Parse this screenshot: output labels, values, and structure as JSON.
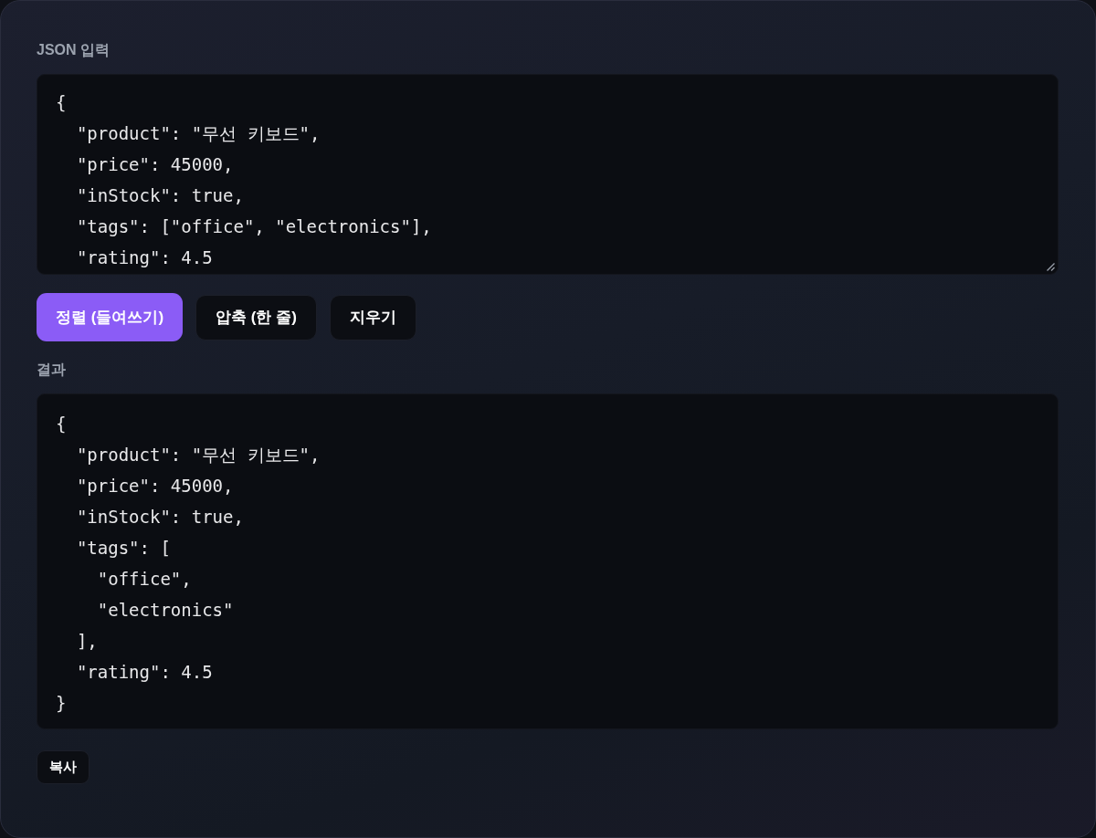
{
  "input": {
    "label": "JSON 입력",
    "value": "{\n  \"product\": \"무선 키보드\",\n  \"price\": 45000,\n  \"inStock\": true,\n  \"tags\": [\"office\", \"electronics\"],\n  \"rating\": 4.5"
  },
  "buttons": [
    {
      "label": "정렬 (들여쓰기)",
      "kind": "primary"
    },
    {
      "label": "압축 (한 줄)",
      "kind": "secondary"
    },
    {
      "label": "지우기",
      "kind": "secondary"
    }
  ],
  "result": {
    "label": "결과",
    "text": "{\n  \"product\": \"무선 키보드\",\n  \"price\": 45000,\n  \"inStock\": true,\n  \"tags\": [\n    \"office\",\n    \"electronics\"\n  ],\n  \"rating\": 4.5\n}",
    "copy_button": "복사"
  }
}
